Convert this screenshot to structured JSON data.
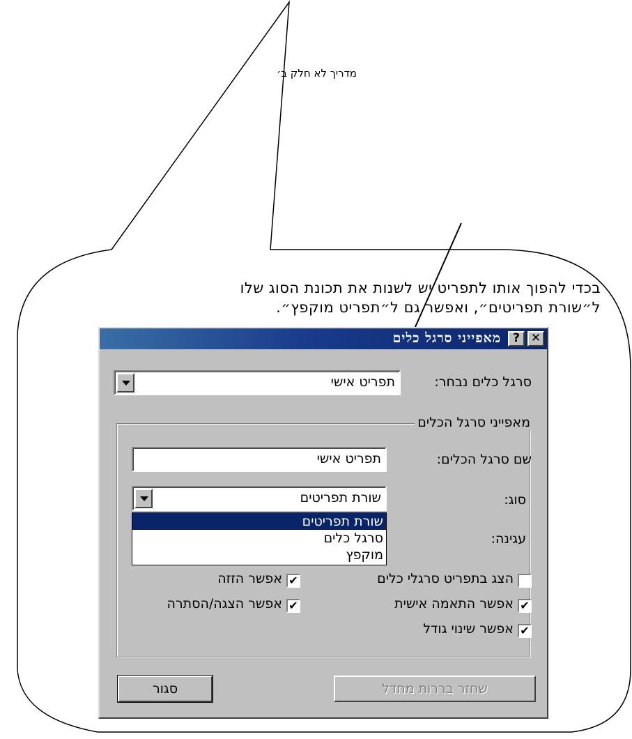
{
  "page": {
    "header": "מדריך לא     חלק ב׳",
    "instruction_line1": "בכדי להפוך אותו לתפריט יש לשנות את תכונת הסוג שלו",
    "instruction_line2": "ל״שורת תפריטים״, ואפשר גם ל״תפריט מוקפץ״."
  },
  "dialog": {
    "title": "מאפייני סרגל כלים",
    "help_label": "?",
    "close_label": "✕",
    "selected_toolbar_label": "סרגל כלים נבחר:",
    "selected_toolbar_value": "תפריט אישי",
    "group_title": "מאפייני סרגל הכלים",
    "toolbar_name_label": "שם סרגל הכלים:",
    "toolbar_name_value": "תפריט אישי",
    "type_label": "סוג:",
    "type_value": "שורת תפריטים",
    "type_options": [
      "שורת תפריטים",
      "סרגל כלים",
      "מוקפץ"
    ],
    "docking_label": "עגינה:",
    "checkboxes": [
      {
        "label": "הצג בתפריט סרגלי כלים",
        "checked": false
      },
      {
        "label": "אפשר הזזה",
        "checked": true
      },
      {
        "label": "אפשר התאמה אישית",
        "checked": true
      },
      {
        "label": "אפשר הצגה/הסתרה",
        "checked": true
      },
      {
        "label": "אפשר שינוי גודל",
        "checked": true
      }
    ],
    "restore_button": "שחזר בררות מחדל",
    "close_button": "סגור"
  },
  "colors": {
    "titlebar": "#0a246a",
    "dialog_face": "#c0c0c0",
    "selection": "#0a246a"
  }
}
